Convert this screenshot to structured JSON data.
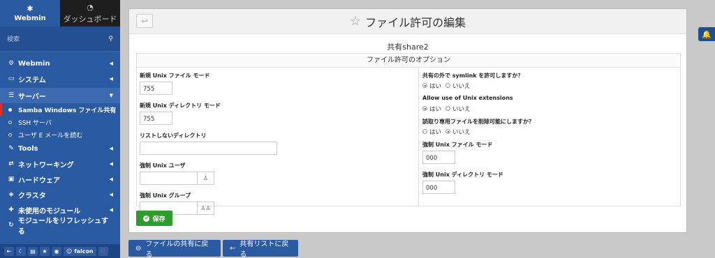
{
  "sidebar": {
    "tabs": [
      {
        "label": "Webmin",
        "icon": "webmin-logo-icon"
      },
      {
        "label": "ダッシュボード",
        "icon": "dashboard-icon"
      }
    ],
    "search_placeholder": "検索",
    "menu": [
      {
        "label": "Webmin",
        "icon": "gear-icon"
      },
      {
        "label": "システム",
        "icon": "monitor-icon"
      },
      {
        "label": "サーバー",
        "icon": "server-icon"
      }
    ],
    "submenu": [
      {
        "label": "Samba Windows ファイル共有",
        "active": true
      },
      {
        "label": "SSH サーバ",
        "active": false
      },
      {
        "label": "ユーザ E メールを読む",
        "active": false
      }
    ],
    "menu2": [
      {
        "label": "Tools",
        "icon": "wrench-icon"
      },
      {
        "label": "ネットワーキング",
        "icon": "network-icon"
      },
      {
        "label": "ハードウェア",
        "icon": "hardware-icon"
      },
      {
        "label": "クラスタ",
        "icon": "cluster-icon"
      },
      {
        "label": "未使用のモジュール",
        "icon": "puzzle-icon"
      },
      {
        "label": "モジュールをリフレッシュする",
        "icon": "refresh-icon"
      }
    ],
    "bottom": {
      "user": "falcon"
    }
  },
  "page": {
    "title": "ファイル許可の編集",
    "share_title": "共有share2",
    "section_title": "ファイル許可のオプション"
  },
  "form": {
    "new_file_mode": {
      "label": "新規 Unix ファイル モード",
      "value": "755"
    },
    "new_dir_mode": {
      "label": "新規 Unix ディレクトリ モード",
      "value": "755"
    },
    "hide_dirs": {
      "label": "リストしないディレクトリ",
      "value": ""
    },
    "force_user": {
      "label": "強制 Unix ユーザ",
      "value": ""
    },
    "force_group": {
      "label": "強制 Unix グループ",
      "value": ""
    },
    "symlink": {
      "label": "共有の外で symlink を許可しますか？",
      "yes": "はい",
      "no": "いいえ",
      "selected": "yes"
    },
    "unix_ext": {
      "label": "Allow use of Unix extensions",
      "yes": "はい",
      "no": "いいえ",
      "selected": "yes"
    },
    "delete_ro": {
      "label": "読取り専用ファイルを削除可能にしますか？",
      "yes": "はい",
      "no": "いいえ",
      "selected": "no"
    },
    "force_file_mode": {
      "label": "強制 Unix ファイル モード",
      "value": "000"
    },
    "force_dir_mode": {
      "label": "強制 Unix ディレクトリ モード",
      "value": "000"
    }
  },
  "buttons": {
    "save": "保存",
    "back_share": "ファイルの共有に戻る",
    "back_list": "共有リストに戻る"
  },
  "colors": {
    "sidebar": "#2a5aa2",
    "save": "#2d9d2d",
    "active_marker": "#d9302c"
  }
}
